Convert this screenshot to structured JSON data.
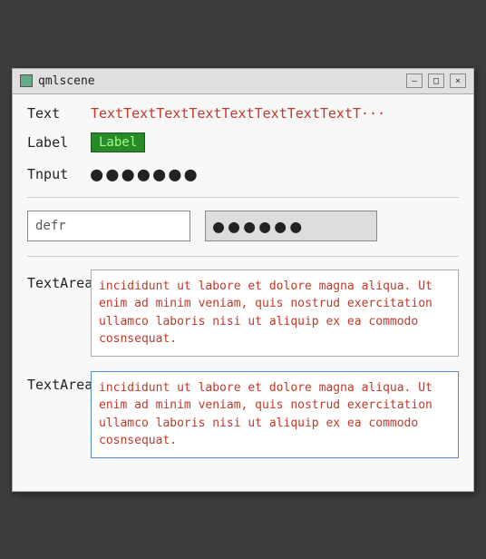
{
  "window": {
    "title": "qmlscene",
    "close_label": "×",
    "maximize_label": "□",
    "minimize_label": "—"
  },
  "rows": {
    "text_label": "Text",
    "text_value": "TextTextTextTextTextTextTextTextT···",
    "label_label": "Label",
    "label_value": "Label",
    "input_label": "Tnput",
    "input_dots": "●●●●●●●",
    "input_field_value": "defr",
    "input_field_placeholder": "defr",
    "input_field_dots": "●●●●●●",
    "textarea_label1": "TextArea",
    "textarea_value1": "incididunt ut labore et dolore magna aliqua. Ut enim ad minim veniam, quis nostrud exercitation ullamco laboris nisi ut aliquip ex ea commodo cosnsequat.",
    "textarea_label2": "TextArea",
    "textarea_value2": "incididunt ut labore et dolore magna aliqua. Ut enim ad minim veniam, quis nostrud exercitation ullamco laboris nisi ut aliquip ex ea commodo cosnsequat."
  }
}
